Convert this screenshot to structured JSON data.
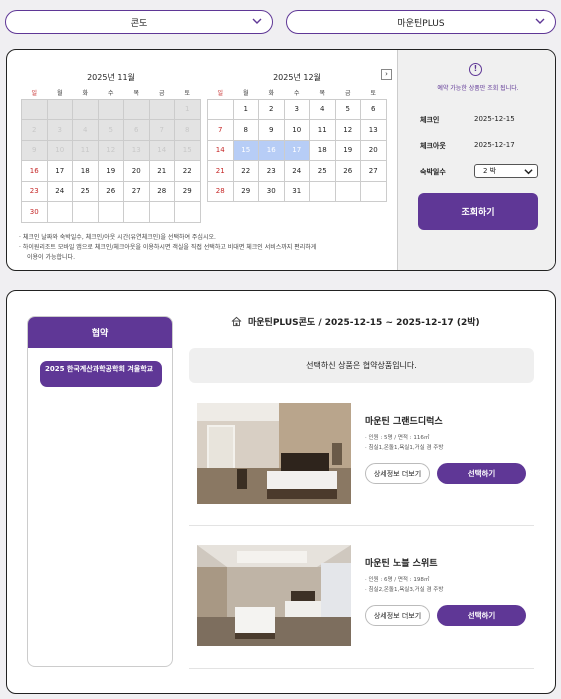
{
  "selectors": {
    "region": "콘도",
    "resort": "마운틴PLUS"
  },
  "calendar": {
    "weekdays": [
      "일",
      "월",
      "화",
      "수",
      "목",
      "금",
      "토"
    ],
    "months": [
      {
        "title": "2025년 11월",
        "weeks": [
          [
            "",
            "",
            "",
            "",
            "",
            "",
            "1"
          ],
          [
            "2",
            "3",
            "4",
            "5",
            "6",
            "7",
            "8"
          ],
          [
            "9",
            "10",
            "11",
            "12",
            "13",
            "14",
            "15"
          ],
          [
            "16",
            "17",
            "18",
            "19",
            "20",
            "21",
            "22"
          ],
          [
            "23",
            "24",
            "25",
            "26",
            "27",
            "28",
            "29"
          ],
          [
            "30",
            "",
            "",
            "",
            "",
            "",
            ""
          ]
        ],
        "disabled_until": 16
      },
      {
        "title": "2025년 12월",
        "weeks": [
          [
            "",
            "1",
            "2",
            "3",
            "4",
            "5",
            "6"
          ],
          [
            "7",
            "8",
            "9",
            "10",
            "11",
            "12",
            "13"
          ],
          [
            "14",
            "15",
            "16",
            "17",
            "18",
            "19",
            "20"
          ],
          [
            "21",
            "22",
            "23",
            "24",
            "25",
            "26",
            "27"
          ],
          [
            "28",
            "29",
            "30",
            "31",
            "",
            "",
            ""
          ]
        ],
        "selected": [
          "15",
          "16",
          "17"
        ]
      }
    ],
    "next_label": "›",
    "notes": [
      "· 체크인 날짜와 숙박일수, 체크인/아웃 시간(유연체크인)을 선택하여 주십시오.",
      "· 하이원리조트 모바일 앱으로 체크인/체크아웃을 이용하시면 객실을 직접 선택하고 비대면 체크인 서비스까지 편리하게",
      "이용이 가능합니다."
    ]
  },
  "booking": {
    "notice": "예약 가능한 상품만 조회 됩니다.",
    "checkin_label": "체크인",
    "checkin_value": "2025-12-15",
    "checkout_label": "체크아웃",
    "checkout_value": "2025-12-17",
    "nights_label": "숙박일수",
    "nights_value": "2 박",
    "search_button": "조회하기"
  },
  "category": {
    "header": "협약",
    "item": "2025 한국계산과학공학회 겨울학교"
  },
  "results": {
    "heading": "마운틴PLUS콘도  /  2025-12-15 ~ 2025-12-17 (2박)",
    "banner": "선택하신 상품은 협약상품입니다.",
    "rooms": [
      {
        "name": "마운틴 그랜드디럭스",
        "spec1": "· 인원 : 5명 / 면적 : 116㎡",
        "spec2": "· 침실1,온돌1,욕실1,거실 겸 주방",
        "detail_button": "상세정보 더보기",
        "select_button": "선택하기"
      },
      {
        "name": "마운틴 노블 스위트",
        "spec1": "· 인원 : 6명 / 면적 : 198㎡",
        "spec2": "· 침실2,온돌1,욕실3,거실 겸 주방",
        "detail_button": "상세정보 더보기",
        "select_button": "선택하기"
      }
    ]
  },
  "colors": {
    "accent": "#5f3796",
    "selected_day": "#b7cdf6",
    "sunday": "#c62828"
  }
}
